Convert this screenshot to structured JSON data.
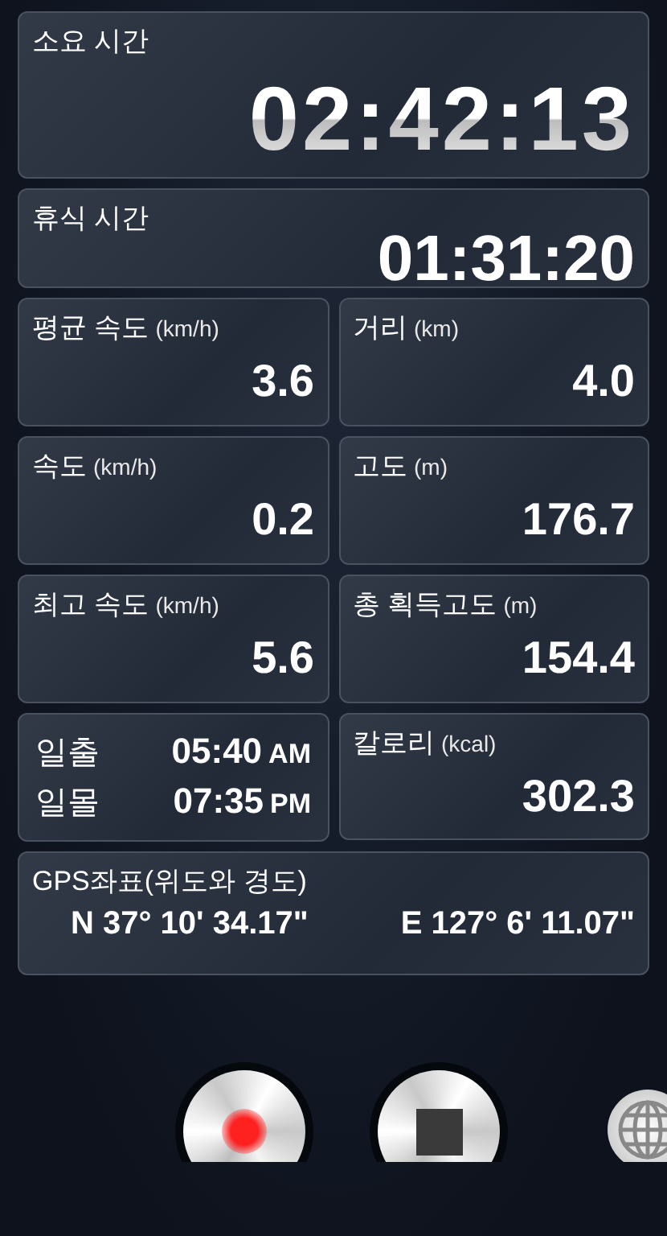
{
  "elapsed": {
    "label": "소요 시간",
    "value": "02:42:13"
  },
  "rest": {
    "label": "휴식 시간",
    "value": "01:31:20"
  },
  "stats": [
    {
      "label": "평균 속도",
      "unit": "(km/h)",
      "value": "3.6"
    },
    {
      "label": "거리",
      "unit": "(km)",
      "value": "4.0"
    },
    {
      "label": "속도",
      "unit": "(km/h)",
      "value": "0.2"
    },
    {
      "label": "고도",
      "unit": "(m)",
      "value": "176.7"
    },
    {
      "label": "최고 속도",
      "unit": "(km/h)",
      "value": "5.6"
    },
    {
      "label": "총 획득고도",
      "unit": "(m)",
      "value": "154.4"
    }
  ],
  "sun": [
    {
      "label": "일출",
      "time": "05:40",
      "period": "AM"
    },
    {
      "label": "일몰",
      "time": "07:35",
      "period": "PM"
    }
  ],
  "calories": {
    "label": "칼로리",
    "unit": "(kcal)",
    "value": "302.3"
  },
  "gps": {
    "label": "GPS좌표(위도와 경도)",
    "latitude": "N 37° 10' 34.17\"",
    "longitude": "E 127° 6' 11.07\""
  },
  "controls": [
    {
      "kind": "record"
    },
    {
      "kind": "stop"
    },
    {
      "kind": "globe"
    }
  ]
}
